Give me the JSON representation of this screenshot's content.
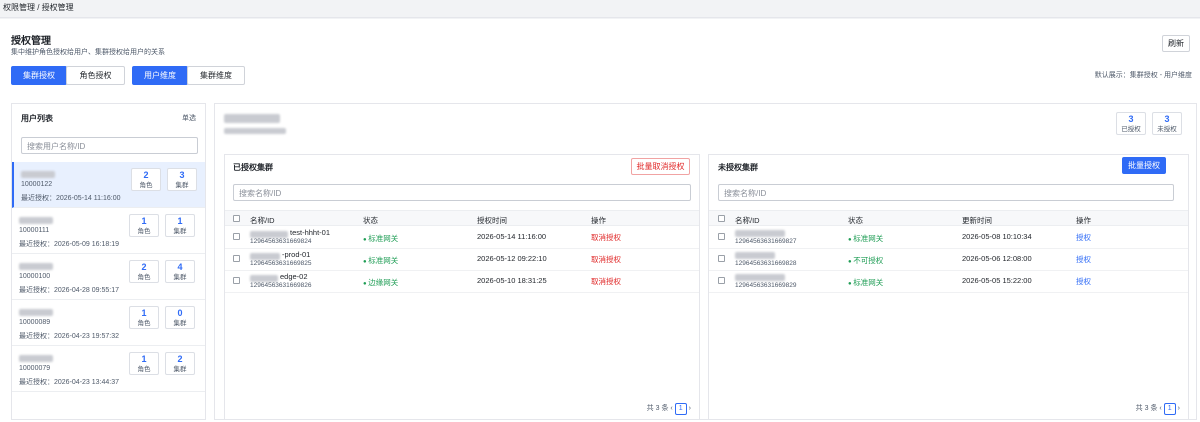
{
  "breadcrumb": "权限管理 / 授权管理",
  "page": {
    "title": "授权管理",
    "description": "集中维护角色授权给用户、集群授权给用户的关系",
    "refresh_label": "刷新",
    "hint": "默认展示：集群授权 - 用户维度"
  },
  "tabs_left": [
    "集群授权",
    "角色授权"
  ],
  "tabs_right": [
    "用户维度",
    "集群维度"
  ],
  "user_list": {
    "title": "用户列表",
    "mode": "单选",
    "search_placeholder": "搜索用户名称/ID",
    "role_label": "角色",
    "cluster_label": "集群",
    "users": [
      {
        "id": "10000122",
        "recent": "最近授权：2026-05-14 11:16:00",
        "roles": "2",
        "clusters": "3"
      },
      {
        "id": "10000111",
        "recent": "最近授权：2026-05-09 16:18:19",
        "roles": "1",
        "clusters": "1"
      },
      {
        "id": "10000100",
        "recent": "最近授权：2026-04-28 09:55:17",
        "roles": "2",
        "clusters": "4"
      },
      {
        "id": "10000089",
        "recent": "最近授权：2026-04-23 19:57:32",
        "roles": "1",
        "clusters": "0"
      },
      {
        "id": "10000079",
        "recent": "最近授权：2026-04-23 13:44:37",
        "roles": "1",
        "clusters": "2"
      }
    ]
  },
  "counts": {
    "authorized": "3",
    "authorized_label": "已授权",
    "unauthorized": "3",
    "unauthorized_label": "未授权"
  },
  "authorized_panel": {
    "title": "已授权集群",
    "batch_label": "批量取消授权",
    "search_placeholder": "搜索名称/ID",
    "columns": [
      "名称/ID",
      "状态",
      "授权时间",
      "操作"
    ],
    "rows": [
      {
        "name": "test-hhht-01",
        "id": "1296456363​1669824",
        "status": "标准网关",
        "time": "2026-05-14 11:16:00",
        "action": "取消授权"
      },
      {
        "name": "-prod-01",
        "id": "12964563631669825",
        "status": "标准网关",
        "time": "2026-05-12 09:22:10",
        "action": "取消授权"
      },
      {
        "name": "edge-02",
        "id": "12964563631669826",
        "status": "边缘网关",
        "time": "2026-05-10 18:31:25",
        "action": "取消授权"
      }
    ],
    "total": "共 3 条",
    "page": "1"
  },
  "unauthorized_panel": {
    "title": "未授权集群",
    "batch_label": "批量授权",
    "search_placeholder": "搜索名称/ID",
    "columns": [
      "名称/ID",
      "状态",
      "更新时间",
      "操作"
    ],
    "rows": [
      {
        "id": "12964563631669827",
        "status": "标准网关",
        "time": "2026-05-08 10:10:34",
        "action": "授权"
      },
      {
        "id": "12964563631669828",
        "status": "不可授权",
        "time": "2026-05-06 12:08:00",
        "action": "授权"
      },
      {
        "id": "12964563631669829",
        "status": "标准网关",
        "time": "2026-05-05 15:22:00",
        "action": "授权"
      }
    ],
    "total": "共 3 条",
    "page": "1"
  },
  "colors": {
    "primary": "#2f6bf6",
    "danger": "#e02828",
    "success": "#1f9d55"
  }
}
